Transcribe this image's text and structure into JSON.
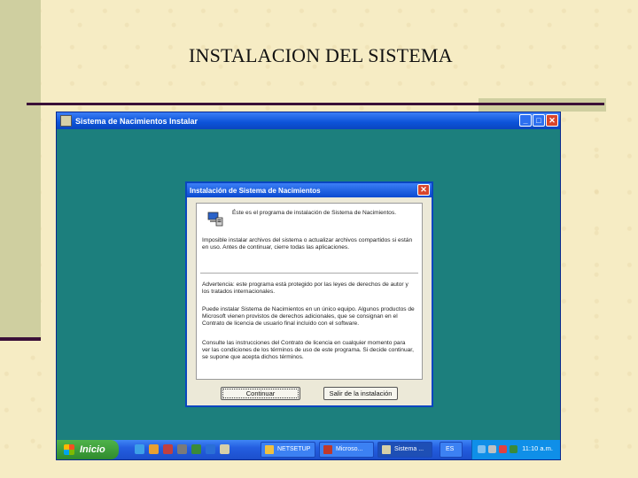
{
  "slide": {
    "title": "INSTALACION DEL SISTEMA"
  },
  "window": {
    "title": "Sistema de Nacimientos Instalar",
    "controls": {
      "minimize": "_",
      "maximize": "□",
      "close": "✕"
    }
  },
  "dialog": {
    "title": "Instalación de Sistema de Nacimientos",
    "close": "✕",
    "intro": "Éste es el programa de instalación de Sistema de Nacimientos.",
    "p1": "Imposible instalar archivos del sistema o actualizar archivos compartidos si están en uso. Antes de continuar, cierre todas las aplicaciones.",
    "p2": "Advertencia: este programa está protegido por las leyes de derechos de autor y los tratados internacionales.",
    "p3": "Puede instalar Sistema de Nacimientos en un único equipo. Algunos productos de Microsoft vienen provistos de derechos adicionales, que se consignan en el Contrato de licencia de usuario final incluido con el software.",
    "p4": "Consulte las instrucciones del Contrato de licencia en cualquier momento para ver las condiciones de los términos de uso de este programa. Si decide continuar, se supone que acepta dichos términos.",
    "continue_button": "Continuar",
    "exit_button": "Salir de la instalación"
  },
  "taskbar": {
    "start_label": "Inicio",
    "tasks": [
      {
        "label": "NETSETUP",
        "icon_color": "#f0c040"
      },
      {
        "label": "Microso...",
        "icon_color": "#c0392b"
      },
      {
        "label": "Sistema ...",
        "icon_color": "#d6d0a8"
      },
      {
        "label": "ES",
        "icon_color": "#2a6fd6"
      }
    ],
    "clock": "11:10 a.m."
  },
  "colors": {
    "desktop": "#1c7f7d",
    "titlebar": "#0c53d8",
    "accent_band": "#cfcfa0",
    "rule": "#3a1038"
  }
}
